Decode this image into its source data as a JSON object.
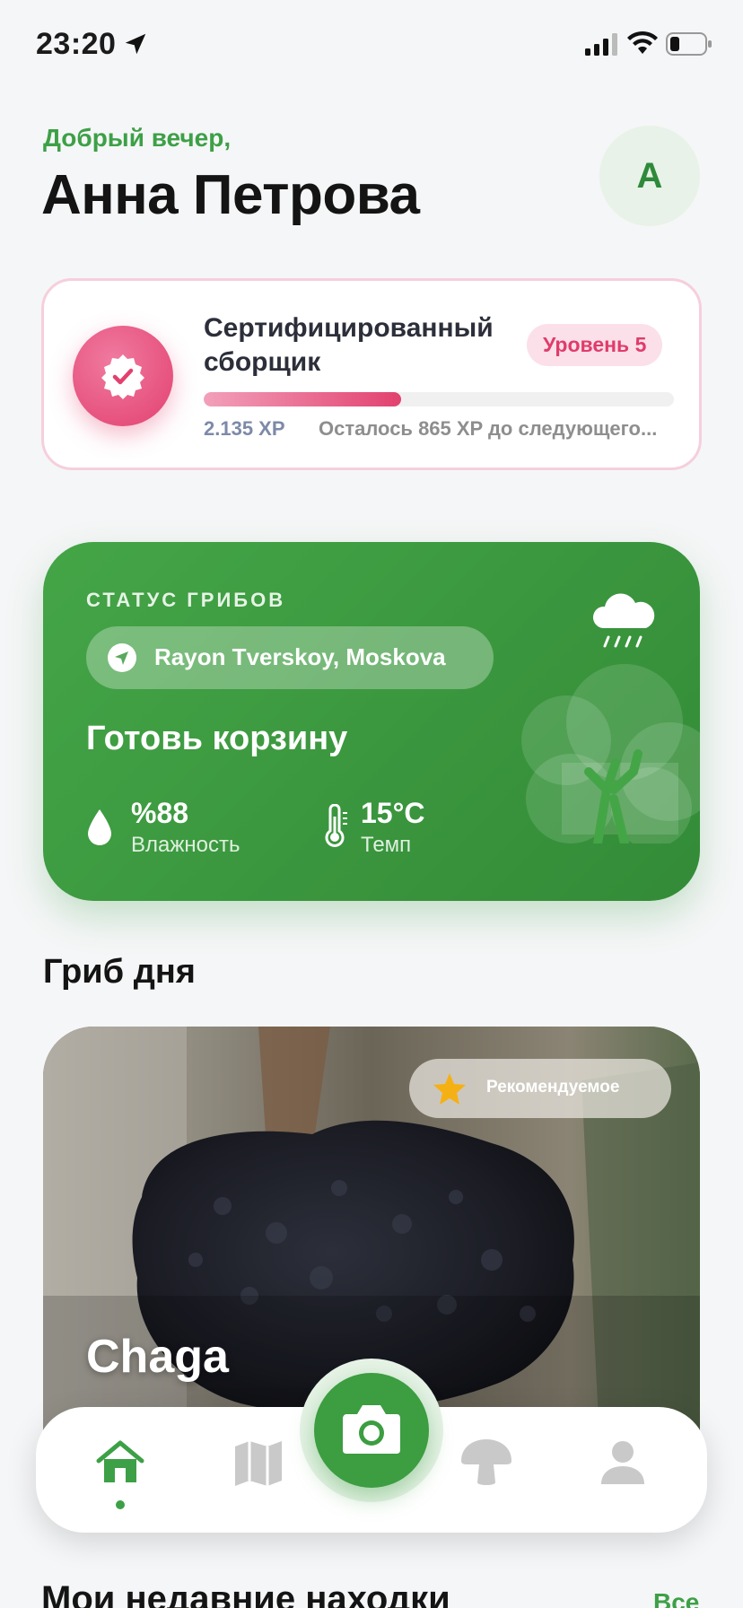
{
  "status_bar": {
    "time": "23:20"
  },
  "header": {
    "greeting": "Добрый вечер,",
    "name": "Анна Петрова",
    "avatar_initial": "A"
  },
  "level": {
    "title": "Сертифицированный сборщик",
    "badge": "Уровень 5",
    "xp": "2.135 XP",
    "remaining": "Осталось 865 XP до следующего...",
    "progress": 0.42,
    "accent": "#e2416f"
  },
  "weather": {
    "label": "СТАТУС ГРИБОВ",
    "location": "Rayon Tverskoy, Moskova",
    "headline": "Готовь корзину",
    "humidity_value": "%88",
    "humidity_label": "Влажность",
    "temp_value": "15°C",
    "temp_label": "Темп",
    "color": "#3da047",
    "icons": [
      "cloud-rain-icon",
      "tree-icon",
      "droplet-icon",
      "thermometer-icon",
      "location-arrow-icon"
    ]
  },
  "mushroom_of_day": {
    "section_title": "Гриб дня",
    "featured": "Рекомендуемое",
    "name": "Chaga"
  },
  "nav": {
    "items": [
      "home-icon",
      "map-icon",
      "camera-icon",
      "mushroom-icon",
      "profile-icon"
    ],
    "active": "home"
  },
  "recent": {
    "title": "Мои недавние находки",
    "all": "Все"
  }
}
